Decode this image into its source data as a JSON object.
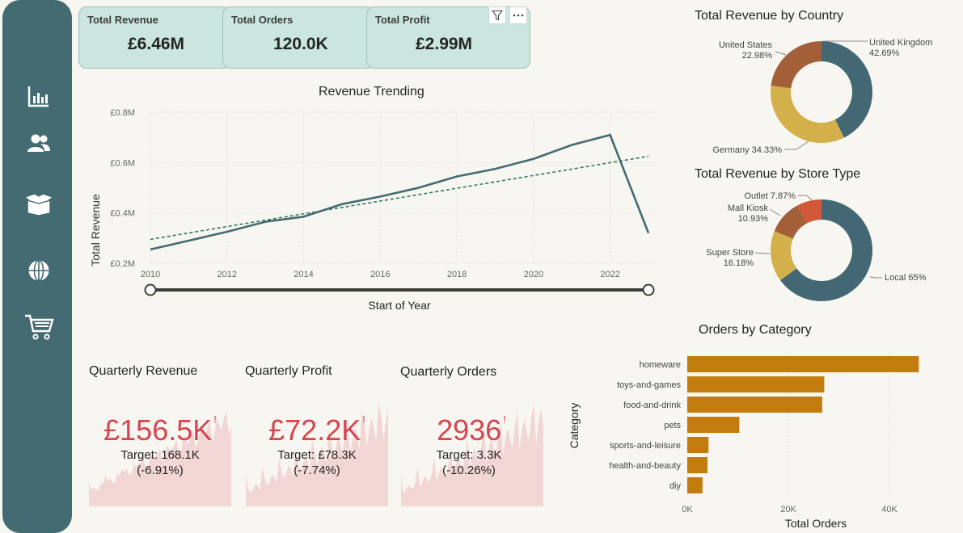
{
  "colors": {
    "accent": "#456b72",
    "kpi_bg": "#cae6de",
    "red": "#d64550",
    "bar": "#c27c0e",
    "dot_trend": "#2f7a5a"
  },
  "nav": {
    "icons": [
      "bar-chart-icon",
      "users-icon",
      "box-icon",
      "globe-icon",
      "cart-icon"
    ]
  },
  "kpis": [
    {
      "label": "Total Revenue",
      "value": "£6.46M"
    },
    {
      "label": "Total Orders",
      "value": "120.0K"
    },
    {
      "label": "Total Profit",
      "value": "£2.99M"
    }
  ],
  "revenue_trend": {
    "title": "Revenue Trending",
    "ylabel": "Total Revenue",
    "xlabel": "Start of Year",
    "y_ticks": [
      "£0.8M",
      "£0.6M",
      "£0.4M",
      "£0.2M"
    ],
    "x_ticks": [
      "2010",
      "2012",
      "2014",
      "2016",
      "2018",
      "2020",
      "2022"
    ]
  },
  "chart_data": [
    {
      "type": "line",
      "title": "Revenue Trending",
      "xlabel": "Start of Year",
      "ylabel": "Total Revenue",
      "x": [
        2010,
        2011,
        2012,
        2013,
        2014,
        2015,
        2016,
        2017,
        2018,
        2019,
        2020,
        2021,
        2022,
        2023
      ],
      "series": [
        {
          "name": "Total Revenue",
          "values": [
            0.255,
            0.29,
            0.325,
            0.365,
            0.385,
            0.435,
            0.465,
            0.5,
            0.545,
            0.575,
            0.615,
            0.67,
            0.71,
            0.32
          ]
        }
      ],
      "trend_line": {
        "start": [
          2010,
          0.295
        ],
        "end": [
          2023,
          0.625
        ]
      },
      "ylim": [
        0.2,
        0.8
      ],
      "xlim": [
        2010,
        2023
      ]
    },
    {
      "type": "pie",
      "title": "Total Revenue by Country",
      "labels": [
        "United Kingdom",
        "Germany",
        "United States"
      ],
      "values": [
        42.69,
        34.33,
        22.98
      ],
      "colors": [
        "#446873",
        "#d4b04a",
        "#a35f37"
      ]
    },
    {
      "type": "pie",
      "title": "Total Revenue by Store Type",
      "labels": [
        "Local",
        "Super Store",
        "Mall Kiosk",
        "Outlet"
      ],
      "values": [
        65,
        16.18,
        10.93,
        7.87
      ],
      "colors": [
        "#446873",
        "#d4b04a",
        "#a35f37",
        "#d25838"
      ]
    },
    {
      "type": "bar",
      "title": "Orders by Category",
      "xlabel": "Total Orders",
      "ylabel": "Category",
      "categories": [
        "homeware",
        "toys-and-games",
        "food-and-drink",
        "pets",
        "sports-and-leisure",
        "health-and-beauty",
        "diy"
      ],
      "values": [
        45800,
        27100,
        26700,
        10300,
        4200,
        4000,
        3000
      ],
      "x_ticks": [
        "0K",
        "20K",
        "40K"
      ],
      "xlim": [
        0,
        48000
      ]
    }
  ],
  "country_labels": [
    {
      "name": "United Kingdom",
      "pct": "42.69%"
    },
    {
      "name": "Germany 34.33%",
      "pct": ""
    },
    {
      "name": "United States",
      "pct": "22.98%"
    }
  ],
  "store_labels": [
    {
      "name": "Outlet 7.87%",
      "pct": ""
    },
    {
      "name": "Mall Kiosk",
      "pct": "10.93%"
    },
    {
      "name": "Super Store",
      "pct": "16.18%"
    },
    {
      "name": "Local 65%",
      "pct": ""
    }
  ],
  "quarterly": [
    {
      "title": "Quarterly Revenue",
      "value": "£156.5K",
      "target": "Target: 168.1K",
      "change": "(-6.91%)"
    },
    {
      "title": "Quarterly Profit",
      "value": "£72.2K",
      "target": "Target: £78.3K",
      "change": "(-7.74%)"
    },
    {
      "title": "Quarterly Orders",
      "value": "2936",
      "target": "Target: 3.3K",
      "change": "(-10.26%)"
    }
  ],
  "excl": "!"
}
